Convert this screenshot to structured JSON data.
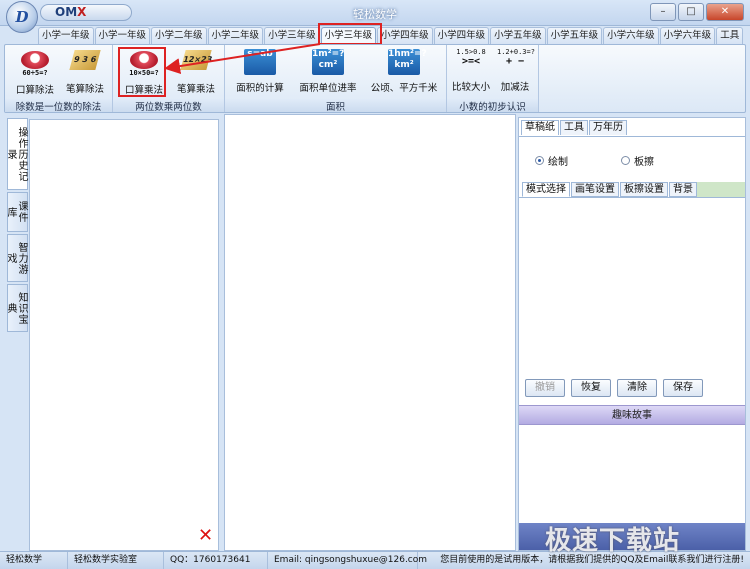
{
  "app": {
    "logo": "D",
    "qat_label": "OM",
    "qat_x": "X",
    "title": "轻松数学"
  },
  "window_buttons": {
    "minimize": "–",
    "maximize": "□",
    "close": "✕"
  },
  "tabs": [
    "小学一年级",
    "小学一年级",
    "小学二年级",
    "小学二年级",
    "小学三年级",
    "小学三年级",
    "小学四年级",
    "小学四年级",
    "小学五年级",
    "小学五年级",
    "小学六年级",
    "小学六年级",
    "工具"
  ],
  "active_tab_index": 5,
  "ribbon": {
    "groups": [
      {
        "caption": "除数是一位数的除法",
        "buttons": [
          {
            "label": "口算除法",
            "expr": "60÷5=?"
          },
          {
            "label": "笔算除法",
            "expr": "9 3 6"
          }
        ]
      },
      {
        "caption": "两位数乘两位数",
        "buttons": [
          {
            "label": "口算乘法",
            "expr": "10×50=?"
          },
          {
            "label": "笔算乘法",
            "expr": "12×23"
          }
        ]
      },
      {
        "caption": "面积",
        "buttons": [
          {
            "label": "面积的计算",
            "expr": "s=ab"
          },
          {
            "label": "面积单位进率",
            "expr": "1m²=?cm²"
          },
          {
            "label": "公顷、平方千米",
            "expr": "1hm²=?km²"
          }
        ]
      },
      {
        "caption": "小数的初步认识",
        "buttons": [
          {
            "label": "比较大小",
            "expr": "1.5>0.8"
          },
          {
            "label": "加减法",
            "expr": "1.2+0.3=?"
          }
        ]
      }
    ]
  },
  "side_tabs": [
    "操作历史记录",
    "课件库",
    "智力游戏",
    "知识宝典"
  ],
  "right_panel": {
    "tabs": [
      "草稿纸",
      "工具",
      "万年历"
    ],
    "radio_draw": "绘制",
    "radio_erase": "板擦",
    "sub_tabs": [
      "模式选择",
      "画笔设置",
      "板擦设置",
      "背景"
    ],
    "buttons": {
      "undo": "撤销",
      "redo": "恢复",
      "clear": "清除",
      "save": "保存"
    },
    "story": "趣味故事"
  },
  "watermark": "极速下载站",
  "status": {
    "app": "轻松数学",
    "lab": "轻松数学实验室",
    "qq": "QQ：1760173641",
    "email": "Email: qingsongshuxue@126.com",
    "message": "您目前使用的是试用版本，请根据我们提供的QQ及Email联系我们进行注册!"
  },
  "colors": {
    "accent": "#4b60a8",
    "highlight": "#d22222"
  }
}
